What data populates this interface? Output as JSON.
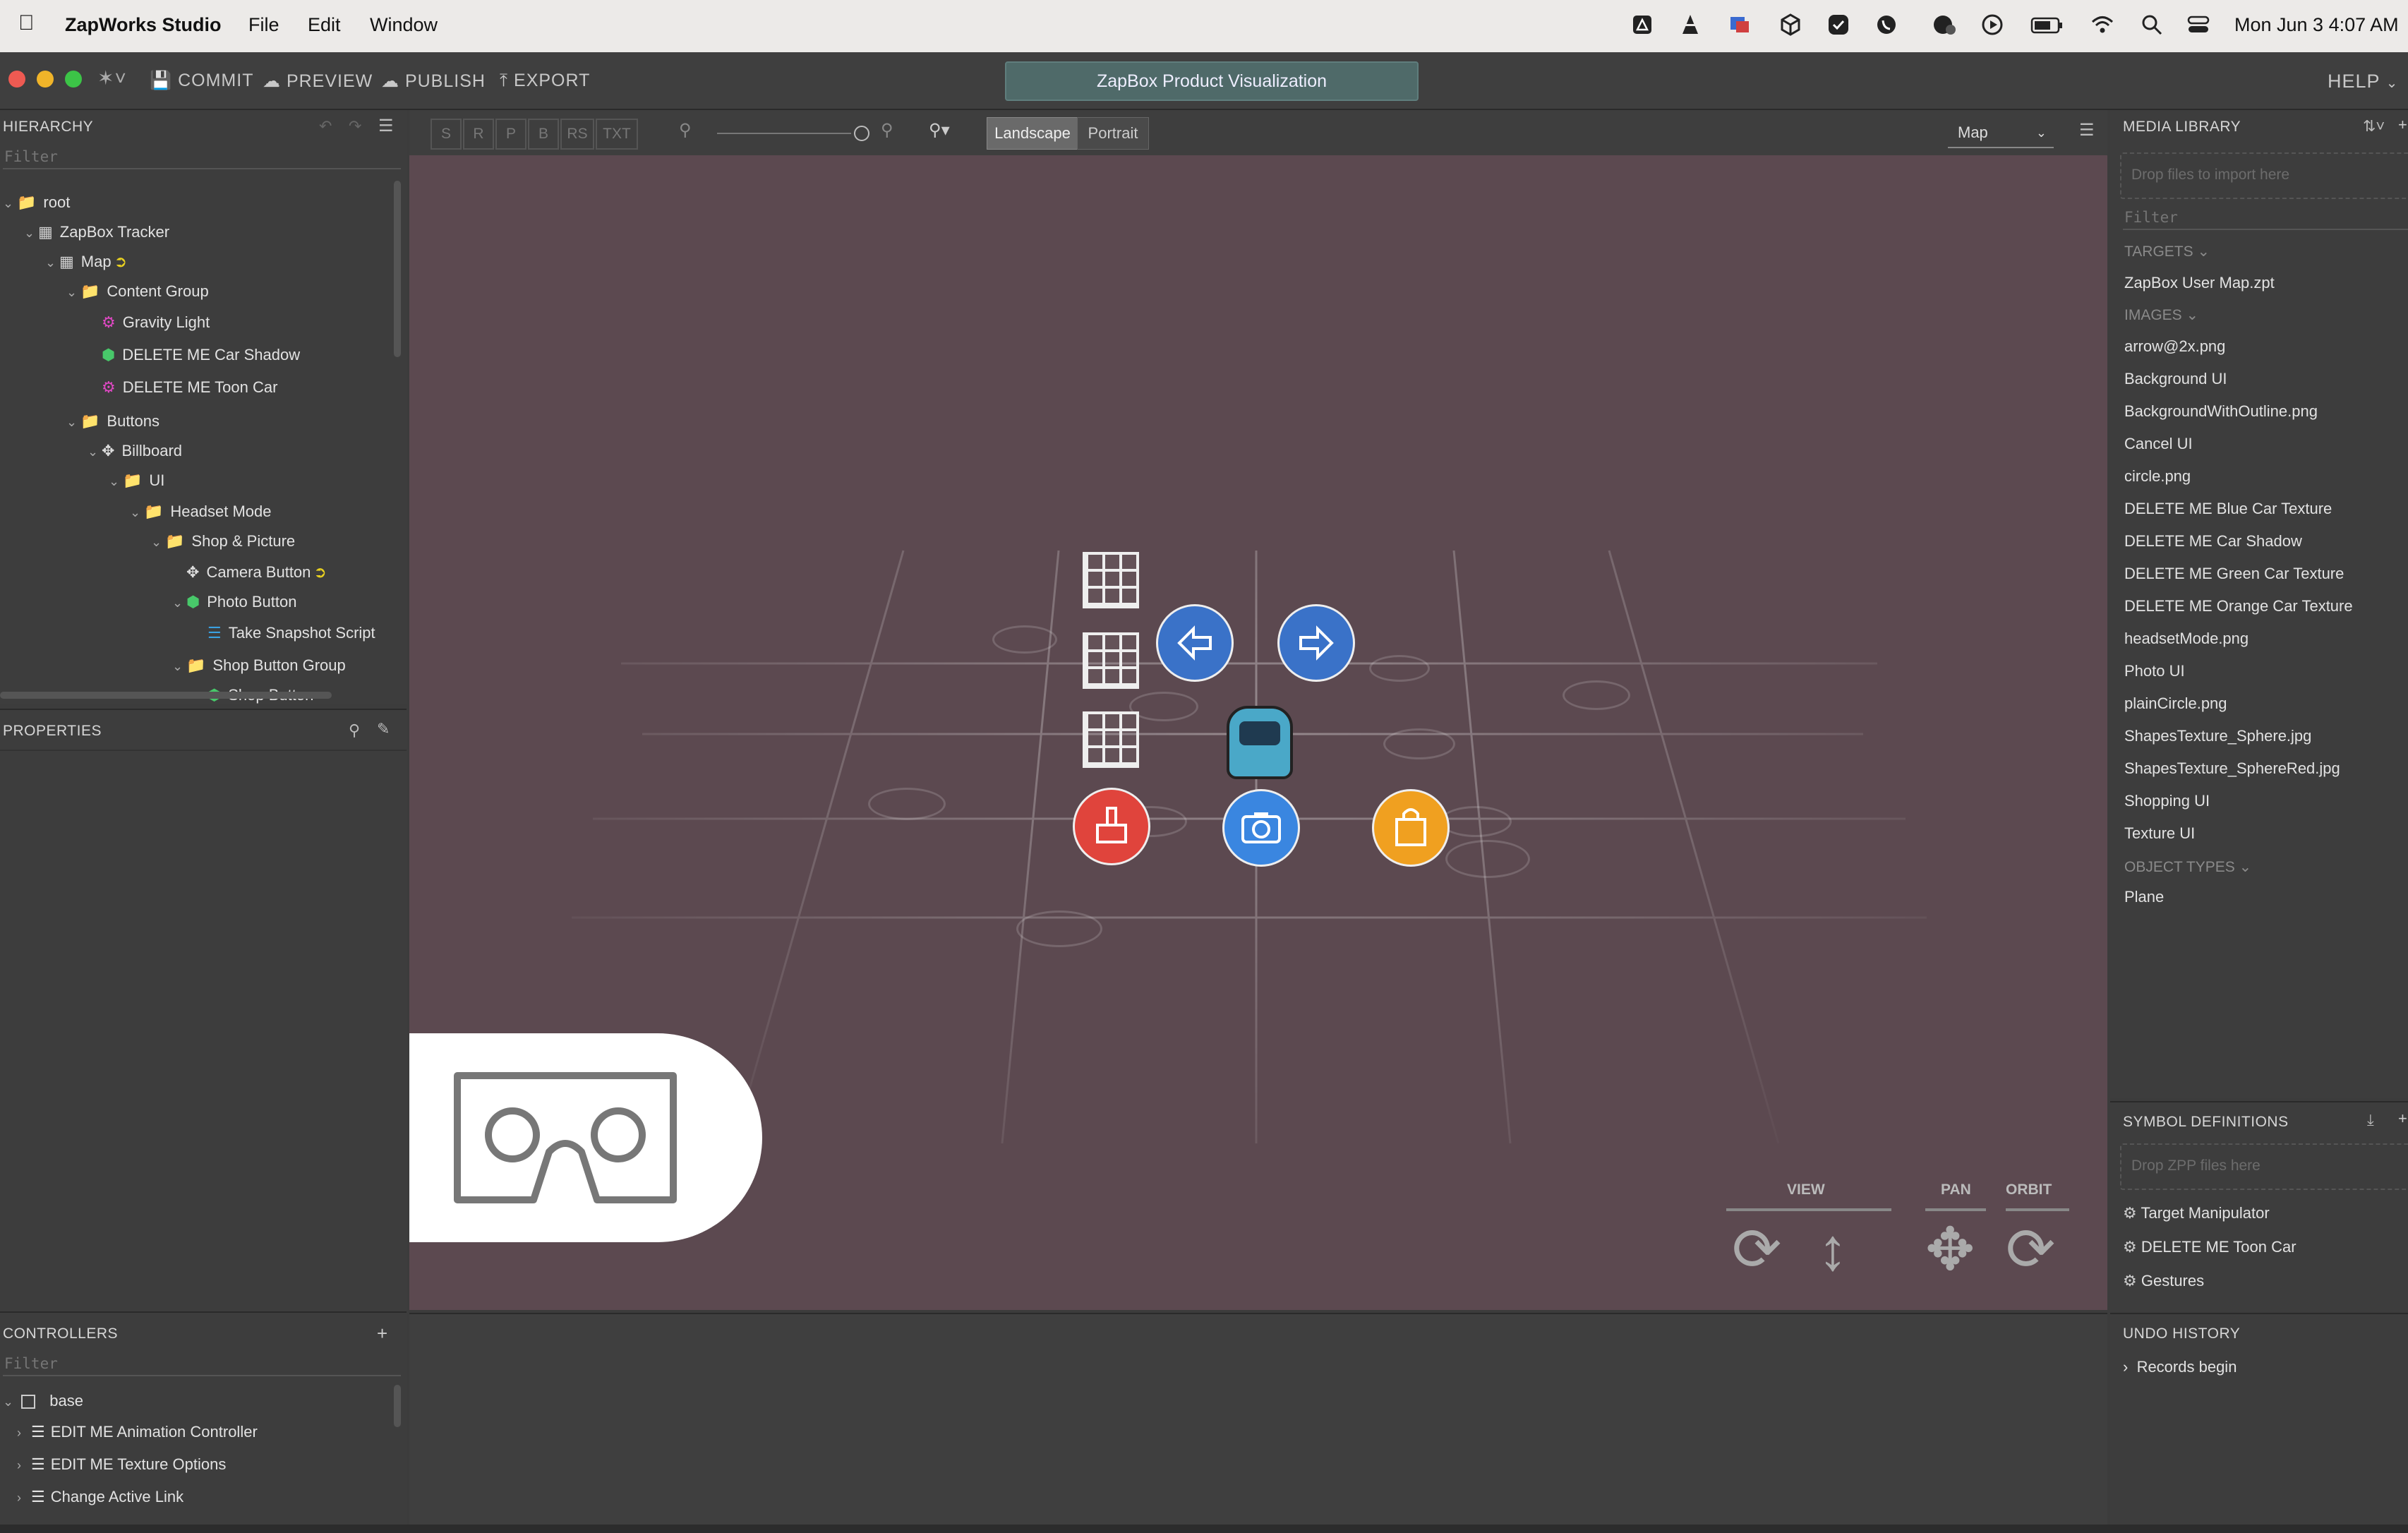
{
  "menubar": {
    "app_name": "ZapWorks Studio",
    "menus": [
      "File",
      "Edit",
      "Window"
    ],
    "clock": "Mon Jun 3  4:07 AM"
  },
  "toolbar": {
    "commit": "COMMIT",
    "preview": "PREVIEW",
    "publish": "PUBLISH",
    "export": "EXPORT",
    "title": "ZapBox Product Visualization",
    "help": "HELP"
  },
  "hierarchy": {
    "header": "HIERARCHY",
    "filter_placeholder": "Filter",
    "items": [
      {
        "label": "root",
        "icon": "folder-icon",
        "depth": 0,
        "caret": "v"
      },
      {
        "label": "ZapBox Tracker",
        "icon": "target-icon",
        "depth": 1,
        "caret": "v"
      },
      {
        "label": "Map",
        "icon": "target-icon",
        "depth": 2,
        "caret": "v",
        "link": true
      },
      {
        "label": "Content Group",
        "icon": "folder-icon",
        "depth": 3,
        "caret": "v"
      },
      {
        "label": "Gravity Light",
        "icon": "gear-icon",
        "depth": 4,
        "caret": ""
      },
      {
        "label": "DELETE ME Car Shadow",
        "icon": "cube-icon",
        "depth": 4,
        "caret": ""
      },
      {
        "label": "DELETE ME Toon Car",
        "icon": "gear-icon",
        "depth": 4,
        "caret": ""
      },
      {
        "label": "Buttons",
        "icon": "folder-icon",
        "depth": 3,
        "caret": "v"
      },
      {
        "label": "Billboard",
        "icon": "move-icon",
        "depth": 4,
        "caret": "v"
      },
      {
        "label": "UI",
        "icon": "folder-icon",
        "depth": 5,
        "caret": "v"
      },
      {
        "label": "Headset Mode",
        "icon": "folder-icon",
        "depth": 6,
        "caret": "v"
      },
      {
        "label": "Shop & Picture",
        "icon": "folder-icon",
        "depth": 7,
        "caret": "v"
      },
      {
        "label": "Camera Button",
        "icon": "move-icon",
        "depth": 8,
        "caret": "",
        "link": true
      },
      {
        "label": "Photo Button",
        "icon": "cube-icon",
        "depth": 8,
        "caret": "v"
      },
      {
        "label": "Take Snapshot Script",
        "icon": "script-icon",
        "depth": 9,
        "caret": ""
      },
      {
        "label": "Shop Button Group",
        "icon": "folder-icon",
        "depth": 8,
        "caret": "v"
      },
      {
        "label": "Shop Button",
        "icon": "cube-icon",
        "depth": 9,
        "caret": ""
      }
    ]
  },
  "properties": {
    "header": "PROPERTIES"
  },
  "controllers": {
    "header": "CONTROLLERS",
    "filter_placeholder": "Filter",
    "items": [
      {
        "label": "base"
      },
      {
        "label": "EDIT ME Animation Controller"
      },
      {
        "label": "EDIT ME Texture Options"
      },
      {
        "label": "Change Active Link"
      }
    ]
  },
  "viewport": {
    "toggles": [
      "S",
      "R",
      "P",
      "B",
      "RS",
      "TXT"
    ],
    "landscape": "Landscape",
    "portrait": "Portrait",
    "view_select": "Map",
    "nav": {
      "view": "VIEW",
      "pan": "PAN",
      "orbit": "ORBIT"
    }
  },
  "media_library": {
    "header": "MEDIA LIBRARY",
    "drop_hint": "Drop files to import here",
    "filter_placeholder": "Filter",
    "targets_label": "TARGETS",
    "targets": [
      "ZapBox User Map.zpt"
    ],
    "images_label": "IMAGES",
    "images": [
      "arrow@2x.png",
      "Background UI",
      "BackgroundWithOutline.png",
      "Cancel UI",
      "circle.png",
      "DELETE ME Blue Car Texture",
      "DELETE ME Car Shadow",
      "DELETE ME Green Car Texture",
      "DELETE ME Orange Car Texture",
      "headsetMode.png",
      "Photo UI",
      "plainCircle.png",
      "ShapesTexture_Sphere.jpg",
      "ShapesTexture_SphereRed.jpg",
      "Shopping UI",
      "Texture UI"
    ],
    "object_types_label": "OBJECT TYPES",
    "object_types": [
      "Plane"
    ]
  },
  "symbol_definitions": {
    "header": "SYMBOL DEFINITIONS",
    "drop_hint": "Drop ZPP files here",
    "items": [
      "Target Manipulator",
      "DELETE ME Toon Car",
      "Gestures"
    ]
  },
  "undo_history": {
    "header": "UNDO HISTORY",
    "items": [
      "Records begin"
    ]
  },
  "colors": {
    "viewport_bg": "#5c4950",
    "title_bg": "#4f6a69",
    "red_button": "#e0443c",
    "blue_button": "#3a7fd8",
    "orange_button": "#f0a020"
  }
}
